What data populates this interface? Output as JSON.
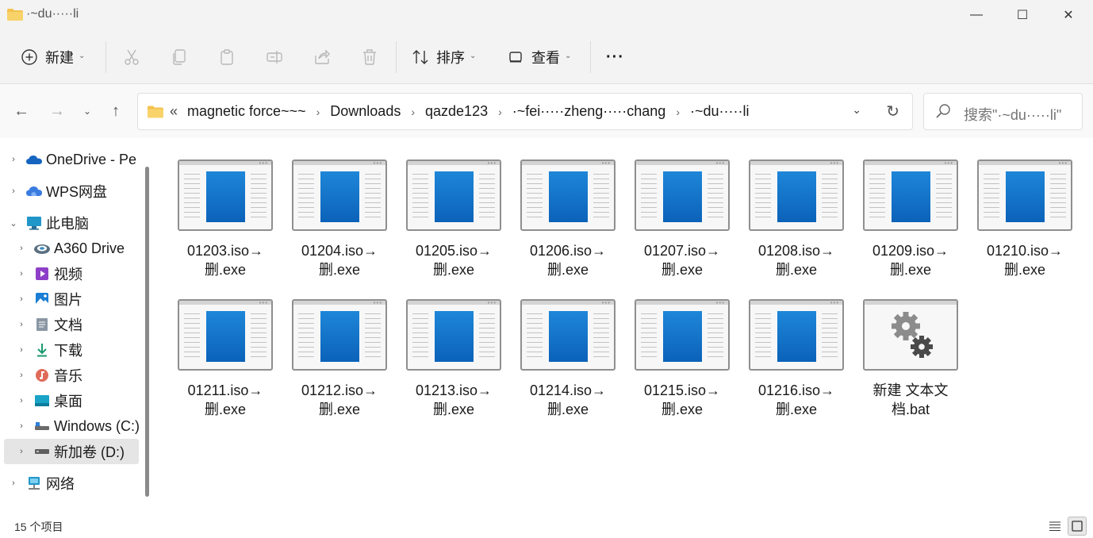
{
  "window": {
    "title": "·~du·····li",
    "minimize": "—",
    "maximize": "☐",
    "close": "✕"
  },
  "toolbar": {
    "new_label": "新建",
    "sort_label": "排序",
    "view_label": "查看",
    "more_label": "···"
  },
  "address": {
    "laquo": "«",
    "crumbs": [
      "magnetic force~~~",
      "Downloads",
      "qazde123",
      "·~fei·····zheng·····chang",
      "·~du·····li"
    ]
  },
  "search": {
    "placeholder": "搜索\"·~du·····li\""
  },
  "sidebar": {
    "items": [
      {
        "label": "OneDrive - Pe",
        "icon": "cloud-icon"
      },
      {
        "label": "WPS网盘",
        "icon": "wps-cloud-icon"
      },
      {
        "label": "此电脑",
        "icon": "computer-icon"
      },
      {
        "label": "A360 Drive",
        "icon": "a360-drive-icon"
      },
      {
        "label": "视频",
        "icon": "video-icon"
      },
      {
        "label": "图片",
        "icon": "pictures-icon"
      },
      {
        "label": "文档",
        "icon": "documents-icon"
      },
      {
        "label": "下载",
        "icon": "download-icon"
      },
      {
        "label": "音乐",
        "icon": "music-icon"
      },
      {
        "label": "桌面",
        "icon": "desktop-icon"
      },
      {
        "label": "Windows (C:)",
        "icon": "drive-icon"
      },
      {
        "label": "新加卷 (D:)",
        "icon": "drive-icon"
      },
      {
        "label": "网络",
        "icon": "network-icon"
      }
    ]
  },
  "files": [
    {
      "line1": "01203.iso→",
      "line2": "删.exe",
      "type": "exe"
    },
    {
      "line1": "01204.iso→",
      "line2": "删.exe",
      "type": "exe"
    },
    {
      "line1": "01205.iso→",
      "line2": "删.exe",
      "type": "exe"
    },
    {
      "line1": "01206.iso→",
      "line2": "删.exe",
      "type": "exe"
    },
    {
      "line1": "01207.iso→",
      "line2": "删.exe",
      "type": "exe"
    },
    {
      "line1": "01208.iso→",
      "line2": "删.exe",
      "type": "exe"
    },
    {
      "line1": "01209.iso→",
      "line2": "删.exe",
      "type": "exe"
    },
    {
      "line1": "01210.iso→",
      "line2": "删.exe",
      "type": "exe"
    },
    {
      "line1": "01211.iso→",
      "line2": "删.exe",
      "type": "exe"
    },
    {
      "line1": "01212.iso→",
      "line2": "删.exe",
      "type": "exe"
    },
    {
      "line1": "01213.iso→",
      "line2": "删.exe",
      "type": "exe"
    },
    {
      "line1": "01214.iso→",
      "line2": "删.exe",
      "type": "exe"
    },
    {
      "line1": "01215.iso→",
      "line2": "删.exe",
      "type": "exe"
    },
    {
      "line1": "01216.iso→",
      "line2": "删.exe",
      "type": "exe"
    },
    {
      "line1": "新建 文本文",
      "line2": "档.bat",
      "type": "bat"
    }
  ],
  "status": {
    "count": "15 个项目"
  },
  "colors": {
    "accent": "#0b62b9",
    "folder": "#f4c24d",
    "selected_bg": "#e5e5e5"
  }
}
